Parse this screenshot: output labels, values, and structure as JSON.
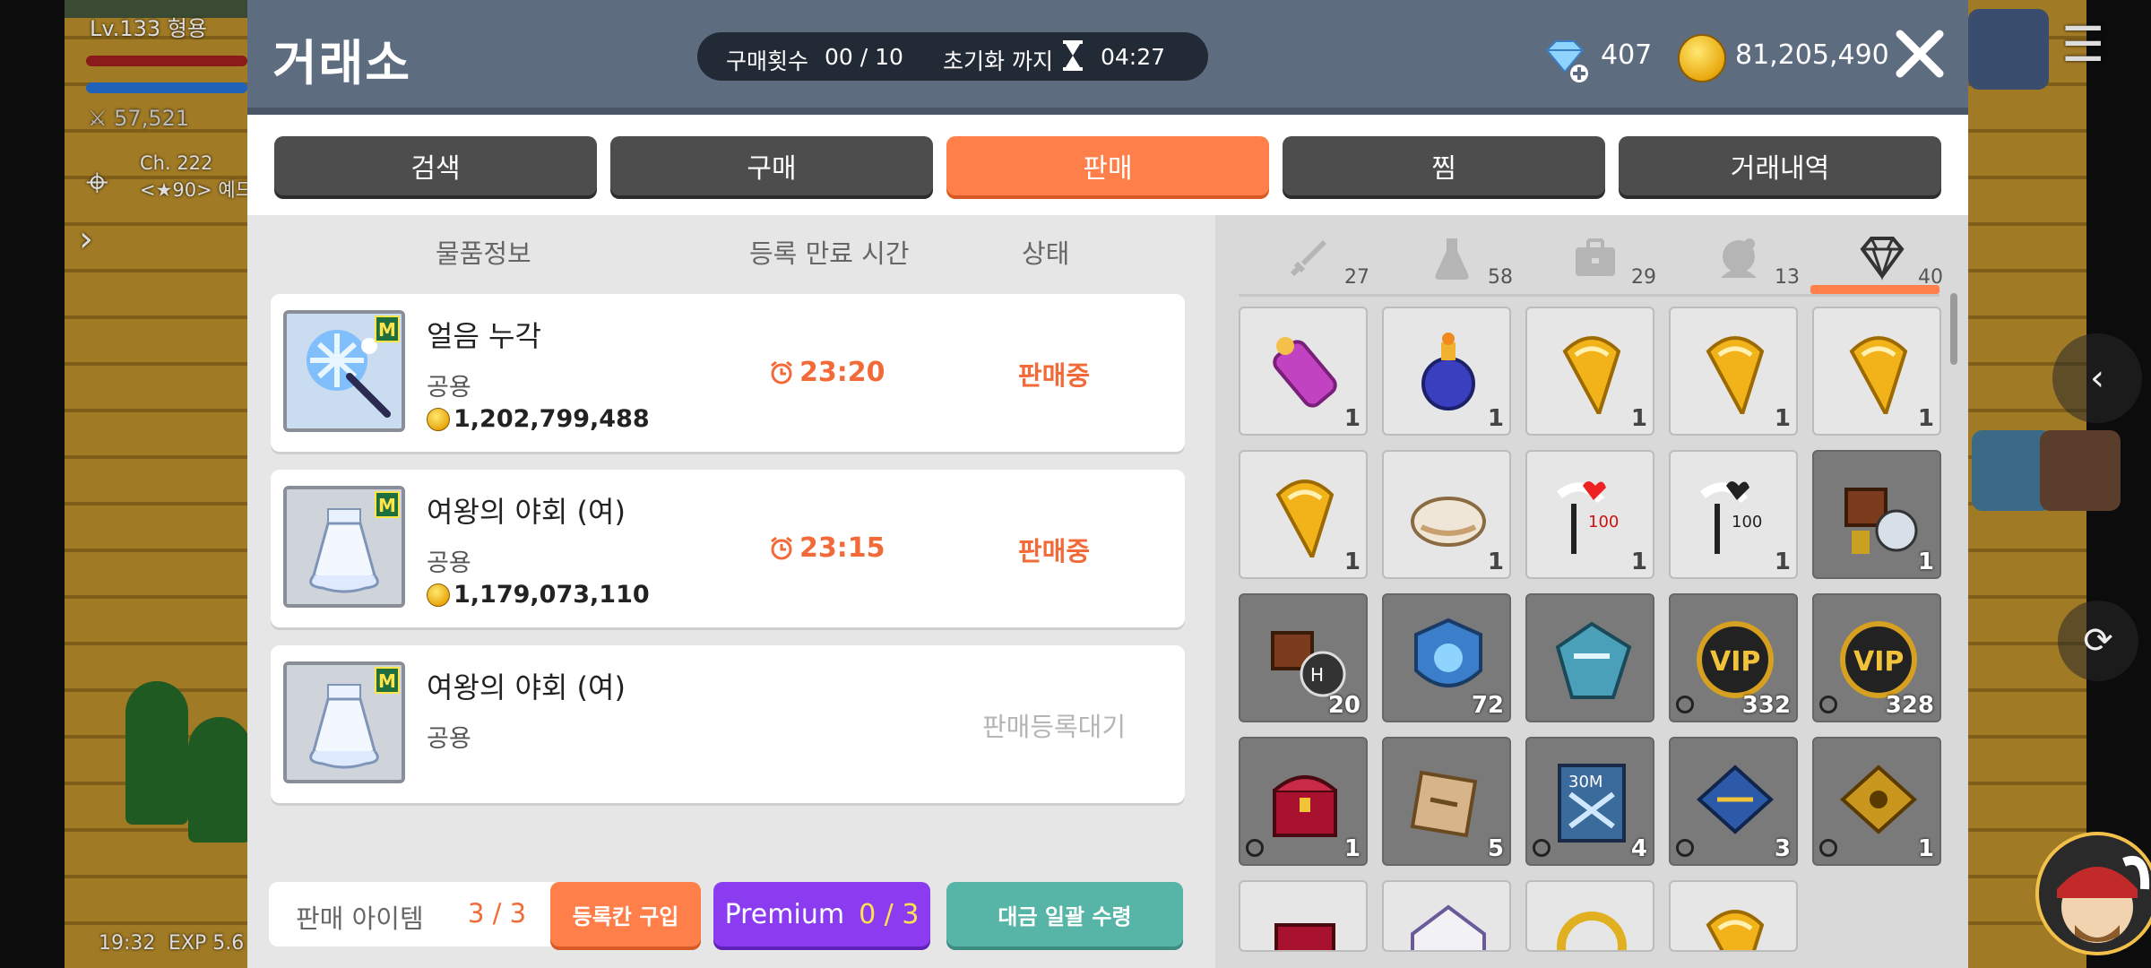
{
  "hud": {
    "level": "Lv.133",
    "name": "형용",
    "power": "57,521",
    "channel": "Ch. 222",
    "map_sub": "<★90> 예드",
    "time": "19:32",
    "exp": "EXP 5.6"
  },
  "header": {
    "title": "거래소",
    "purchase_count_label": "구매횟수",
    "purchase_count_value": "00 / 10",
    "reset_label": "초기화 까지",
    "reset_time": "04:27",
    "diamond_amount": "407",
    "meso_amount": "81,205,490"
  },
  "tabs": [
    {
      "label": "검색"
    },
    {
      "label": "구매"
    },
    {
      "label": "판매"
    },
    {
      "label": "찜"
    },
    {
      "label": "거래내역"
    }
  ],
  "active_tab": "판매",
  "columns": {
    "item_info": "물품정보",
    "expire_time": "등록 만료 시간",
    "status": "상태"
  },
  "listings": [
    {
      "name": "얼음 누각",
      "job": "공용",
      "price": "1,202,799,488",
      "time": "23:20",
      "status": "판매중",
      "icon": "ice-staff-icon"
    },
    {
      "name": "여왕의 야회 (여)",
      "job": "공용",
      "price": "1,179,073,110",
      "time": "23:15",
      "status": "판매중",
      "icon": "queen-dress-icon"
    },
    {
      "name": "여왕의 야회 (여)",
      "job": "공용",
      "price": "",
      "time": "",
      "status": "판매등록대기",
      "icon": "queen-dress-icon"
    }
  ],
  "bottom": {
    "sale_items_label": "판매 아이템",
    "sale_items_value": "3 / 3",
    "buy_slot_label": "등록칸 구입",
    "premium_label": "Premium",
    "premium_value": "0 / 3",
    "claim_label": "대금 일괄 수령"
  },
  "inventory_tabs": [
    {
      "icon": "sword-icon",
      "count": "27"
    },
    {
      "icon": "potion-icon",
      "count": "58"
    },
    {
      "icon": "bag-icon",
      "count": "29"
    },
    {
      "icon": "costume-icon",
      "count": "13"
    },
    {
      "icon": "diamond-icon",
      "count": "40"
    }
  ],
  "inventory_items": [
    {
      "icon": "scroll-tube-icon",
      "qty": "1",
      "dark": false,
      "clock": false
    },
    {
      "icon": "blue-potion-icon",
      "qty": "1",
      "dark": false,
      "clock": false
    },
    {
      "icon": "gold-leaf-icon",
      "qty": "1",
      "dark": false,
      "clock": false
    },
    {
      "icon": "gold-leaf-icon",
      "qty": "1",
      "dark": false,
      "clock": false
    },
    {
      "icon": "gold-leaf-icon",
      "qty": "1",
      "dark": false,
      "clock": false
    },
    {
      "icon": "gold-leaf-icon",
      "qty": "1",
      "dark": false,
      "clock": false
    },
    {
      "icon": "bread-icon",
      "qty": "1",
      "dark": false,
      "clock": false
    },
    {
      "icon": "winged-heart-100-icon",
      "qty": "1",
      "dark": false,
      "clock": false
    },
    {
      "icon": "winged-black-100-icon",
      "qty": "1",
      "dark": false,
      "clock": false
    },
    {
      "icon": "coupon-machine-icon",
      "qty": "1",
      "dark": true,
      "clock": false
    },
    {
      "icon": "club-h-icon",
      "qty": "20",
      "dark": true,
      "clock": false
    },
    {
      "icon": "shield-badge-icon",
      "qty": "72",
      "dark": true,
      "clock": false
    },
    {
      "icon": "crystal-map-icon",
      "qty": "",
      "dark": true,
      "clock": false
    },
    {
      "icon": "vip-icon",
      "qty": "332",
      "dark": true,
      "clock": true
    },
    {
      "icon": "vip-icon",
      "qty": "328",
      "dark": true,
      "clock": true
    },
    {
      "icon": "treasure-chest-icon",
      "qty": "1",
      "dark": true,
      "clock": true
    },
    {
      "icon": "ticket-icon",
      "qty": "5",
      "dark": true,
      "clock": false
    },
    {
      "icon": "30m-card-icon",
      "qty": "4",
      "dark": true,
      "clock": true
    },
    {
      "icon": "blue-envelope-icon",
      "qty": "3",
      "dark": true,
      "clock": true
    },
    {
      "icon": "gold-envelope-icon",
      "qty": "1",
      "dark": true,
      "clock": true
    },
    {
      "icon": "box-icon",
      "qty": "",
      "dark": false,
      "clock": false
    },
    {
      "icon": "letter-icon",
      "qty": "",
      "dark": false,
      "clock": false
    },
    {
      "icon": "gold-ring-icon",
      "qty": "",
      "dark": false,
      "clock": false
    },
    {
      "icon": "gold-leaf-icon",
      "qty": "",
      "dark": false,
      "clock": false
    }
  ]
}
